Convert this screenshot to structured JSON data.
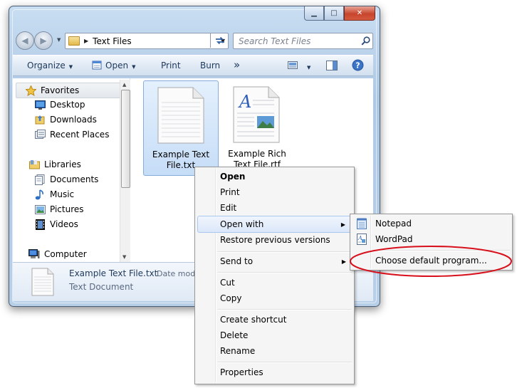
{
  "window": {
    "minimize_glyph": "▁",
    "maximize_glyph": "□",
    "close_glyph": "✕"
  },
  "address": {
    "path_separator": "▶",
    "path": "Text Files",
    "search_placeholder": "Search Text Files"
  },
  "command_bar": {
    "organize": "Organize",
    "open": "Open",
    "print": "Print",
    "burn": "Burn",
    "more": "»"
  },
  "nav_pane": {
    "favorites": "Favorites",
    "desktop": "Desktop",
    "downloads": "Downloads",
    "recent_places": "Recent Places",
    "libraries": "Libraries",
    "documents": "Documents",
    "music": "Music",
    "pictures": "Pictures",
    "videos": "Videos",
    "computer": "Computer"
  },
  "files": [
    {
      "name_line1": "Example Text",
      "name_line2": "File.txt",
      "icon": "text-file-icon"
    },
    {
      "name_line1": "Example Rich",
      "name_line2": "Text File.rtf",
      "icon": "rtf-file-icon"
    }
  ],
  "details": {
    "name": "Example Text File.txt",
    "date_label": "Date modi",
    "type": "Text Document"
  },
  "context_menu": {
    "open": "Open",
    "print": "Print",
    "edit": "Edit",
    "open_with": "Open with",
    "restore": "Restore previous versions",
    "send_to": "Send to",
    "cut": "Cut",
    "copy": "Copy",
    "create_shortcut": "Create shortcut",
    "delete": "Delete",
    "rename": "Rename",
    "properties": "Properties"
  },
  "submenu": {
    "notepad": "Notepad",
    "wordpad": "WordPad",
    "choose_default": "Choose default program..."
  },
  "colors": {
    "annotation": "#d8101b",
    "selection": "#c6ddf7"
  }
}
